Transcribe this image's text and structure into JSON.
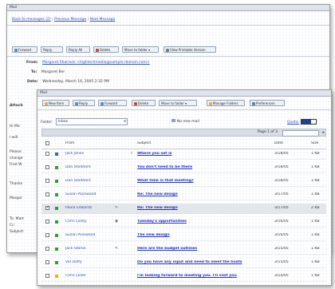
{
  "back_window": {
    "title": "Mail",
    "links": {
      "back": "Back to messages (2)",
      "previous": "Previous Message",
      "next": "Next Message"
    },
    "toolbar": [
      "Forward",
      "Reply",
      "Reply All",
      "Delete",
      "Move to folder",
      "View Printable Version"
    ],
    "from_label": "From:",
    "from_value": "Margaret Sharrock <hightechmedia@sample-domain.com>",
    "to_label": "To:",
    "to_value": "Margaret Ber",
    "date_label": "Date:",
    "date_value": "Wednesday, March 16, 2005 2:32 PM",
    "side_labels": [
      "Attach",
      "Hi Ma",
      "I will",
      "Please",
      "change",
      "Fred W",
      "Thanks",
      "Margar",
      "To: Mart",
      "Cc:",
      "Subject:"
    ]
  },
  "front_window": {
    "title": "Mail",
    "toolbar": [
      "New Item",
      "Reply",
      "Forward",
      "Delete",
      "Move to folder",
      "Manage Folders",
      "Preferences"
    ],
    "folder_label": "Folder:",
    "folder_value": "Inbox",
    "new_mail_text": "No new mail",
    "quota_label": "Quota:",
    "pager_text": "Page 1 of 3",
    "columns": {
      "from": "From",
      "subject": "Subject",
      "date": "Date",
      "size": "Size"
    },
    "colors": {
      "status_green": "#2ca02c",
      "status_blue": "#2f5fd0",
      "status_yellow": "#e8b400",
      "selected_row": "#e3e6ea"
    },
    "rows": [
      {
        "from": "Jack Jones",
        "flag": "!",
        "icon": "",
        "subject": "Where you set is",
        "date": "3/18/05",
        "size": "1 KB",
        "status": "blue",
        "checked": false,
        "selected": false
      },
      {
        "from": "Dan Stoddard",
        "flag": "",
        "icon": "",
        "subject": "You don't need to be there",
        "date": "3/18/05",
        "size": "1 KB",
        "status": "green",
        "checked": false,
        "selected": false
      },
      {
        "from": "Dan Stoddard",
        "flag": "",
        "icon": "",
        "subject": "What time is that meeting?",
        "date": "3/18/05",
        "size": "1 KB",
        "status": "green",
        "checked": false,
        "selected": false
      },
      {
        "from": "Susan Pacewood",
        "flag": "",
        "icon": "",
        "subject": "Re: The new design",
        "date": "3/17/05",
        "size": "1 KB",
        "status": "green",
        "checked": false,
        "selected": false
      },
      {
        "from": "Paula Edwards",
        "flag": "",
        "icon": "✎",
        "subject": "Re: The new design",
        "date": "3/17/05",
        "size": "2 KB",
        "status": "green",
        "checked": true,
        "selected": true
      },
      {
        "from": "Chris Lolley",
        "flag": "",
        "icon": "◉",
        "subject": "Tuesday's opportunities",
        "date": "3/16/05",
        "size": "1 KB",
        "status": "green",
        "checked": false,
        "selected": false
      },
      {
        "from": "Susan Pinewood",
        "flag": "",
        "icon": "",
        "subject": "The new design",
        "date": "3/16/05",
        "size": "1 KB",
        "status": "green",
        "checked": false,
        "selected": false
      },
      {
        "from": "Jack Starke",
        "flag": "",
        "icon": "✎",
        "subject": "Here are the budget outlines",
        "date": "3/15/05",
        "size": "1 KB",
        "status": "green",
        "checked": false,
        "selected": false
      },
      {
        "from": "Val Duffy",
        "flag": "",
        "icon": "",
        "subject": "Do you have any input and need to meet the hosts",
        "date": "3/15/05",
        "size": "1 KB",
        "status": "green",
        "checked": false,
        "selected": false
      },
      {
        "from": "Chris Leller",
        "flag": "",
        "icon": "",
        "subject": "I'm looking forward to meeting you. I'll visit you",
        "date": "3/14/05",
        "size": "1 KB",
        "status": "yellow",
        "checked": false,
        "selected": false
      }
    ]
  }
}
